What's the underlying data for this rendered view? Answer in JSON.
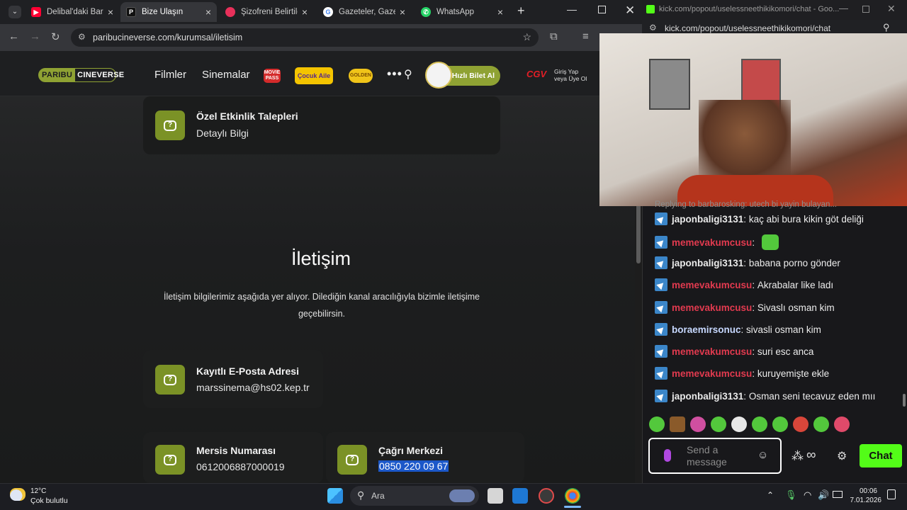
{
  "browser": {
    "tabs": [
      {
        "title": "Delibal'daki Barış",
        "icon": "youtube-icon",
        "color": "#ff0033"
      },
      {
        "title": "Bize Ulaşın",
        "icon": "paribu-icon",
        "color": "#111111"
      },
      {
        "title": "Şizofreni Belirtileri",
        "icon": "site-icon",
        "color": "#e8305a"
      },
      {
        "title": "Gazeteler, Gazete",
        "icon": "google-icon",
        "color": "#4285f4"
      },
      {
        "title": "WhatsApp",
        "icon": "whatsapp-icon",
        "color": "#25d366"
      }
    ],
    "url": "paribucineverse.com/kurumsal/iletisim"
  },
  "site": {
    "logo_part1": "PARIBU",
    "logo_part2": "CINEVERSE",
    "nav": {
      "films": "Filmler",
      "cinemas": "Sinemalar"
    },
    "badges": {
      "moviepass": "MOVIE PASS",
      "cocuk": "Çocuk Aile",
      "golden": "GOLDEN"
    },
    "buy_ticket": "Hızlı Bilet Al",
    "cgv": "CGV",
    "login_line1": "Giriş Yap",
    "login_line2": "veya Üye Ol"
  },
  "page": {
    "event_card": {
      "title": "Özel Etkinlik Talepleri",
      "value": "Detaylı Bilgi"
    },
    "title": "İletişim",
    "description": "İletişim bilgilerimiz aşağıda yer alıyor. Dilediğin kanal aracılığıyla bizimle iletişime geçebilirsin.",
    "email_card": {
      "label": "Kayıtlı E-Posta Adresi",
      "value": "marssinema@hs02.kep.tr"
    },
    "mersis_card": {
      "label": "Mersis Numarası",
      "value": "0612006887000019"
    },
    "call_card": {
      "label": "Çağrı Merkezi",
      "value": "0850 220 09 67"
    },
    "qicon_glyph": "?"
  },
  "chat_window": {
    "title": "kick.com/popout/uselessneethikikomori/chat - Goo...",
    "url": "kick.com/popout/uselessneethikikomori/chat",
    "reply_note": "Replying to barbarosking: utech bi yayin bulayan...",
    "messages": [
      {
        "user": "japonbaligi3131",
        "color": "white",
        "text": "kaç abi bura kikin göt deliği"
      },
      {
        "user": "memevakumcusu",
        "color": "red",
        "text": ""
      },
      {
        "user": "japonbaligi3131",
        "color": "white",
        "text": "babana porno gönder"
      },
      {
        "user": "memevakumcusu",
        "color": "red",
        "text": "Akrabalar like ladı"
      },
      {
        "user": "memevakumcusu",
        "color": "red",
        "text": "Sivaslı osman kim"
      },
      {
        "user": "boraemirsonuc",
        "color": "blue",
        "text": "sivasli osman kim"
      },
      {
        "user": "memevakumcusu",
        "color": "red",
        "text": "suri esc anca"
      },
      {
        "user": "memevakumcusu",
        "color": "red",
        "text": "kuruyemişte ekle"
      },
      {
        "user": "japonbaligi3131",
        "color": "white",
        "text": "Osman seni tecavuz eden mıı"
      }
    ],
    "input_placeholder": "Send a message",
    "chat_button": "Chat",
    "colors": {
      "red": "#e23a4f",
      "white": "#eaeaea",
      "blue": "#c7d8ff",
      "kick_green": "#53fc18"
    }
  },
  "taskbar": {
    "weather_temp": "12°C",
    "weather_desc": "Çok bulutlu",
    "search": "Ara",
    "time": "00:06",
    "date": "7.01.2026"
  }
}
